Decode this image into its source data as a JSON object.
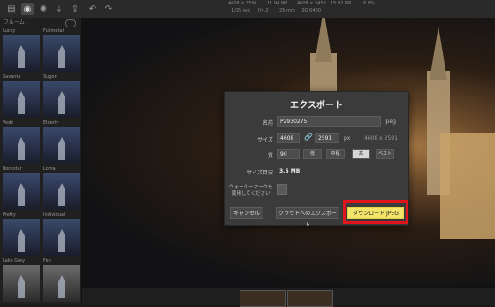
{
  "toolbar": {
    "icons": [
      "layers-icon",
      "photo-icon",
      "effects-icon",
      "download-icon",
      "share-icon",
      "undo-icon",
      "redo-icon"
    ],
    "meta_row1": [
      "4608 × 2591",
      "11.94 MP",
      "4608 × 3456",
      "15.92 MP",
      "16.9%"
    ],
    "meta_row2": [
      "1/25 sec",
      "f/4.2",
      "25 mm",
      "ISO 6400"
    ]
  },
  "sidebar": {
    "header": "フルーム",
    "filters": [
      {
        "left": "Lucky",
        "right": "Fullmetal"
      },
      {
        "left": "Savanta",
        "right": "Sugon"
      },
      {
        "left": "Vodz",
        "right": "Elderly"
      },
      {
        "left": "Rockstar",
        "right": "Loma"
      },
      {
        "left": "Pretty",
        "right": "Individual"
      },
      {
        "left": "Lake Grey",
        "right": "Fen"
      }
    ]
  },
  "dialog": {
    "title": "エクスポート",
    "name_label": "名前",
    "name_value": "P2930275",
    "ext": "jpeg",
    "size_label": "サイズ",
    "width": "4608",
    "height": "2591",
    "unit": "px",
    "orig_size": "4608 x 2591",
    "quality_label": "質",
    "quality_value": "90",
    "quality_options": [
      "低",
      "中程",
      "高",
      "ベスト"
    ],
    "selected_quality_index": 2,
    "estimate_label": "サイズ目安",
    "estimate_value": "3.5 MB",
    "watermark_label_line1": "ウォーターマークを",
    "watermark_label_line2": "使用してください",
    "cancel": "キャンセル",
    "cloud": "クラウドへのエクスポート",
    "download": "ダウンロード JPEG"
  },
  "colors": {
    "primary_button": "#f3e46a",
    "highlight": "#e0141c"
  }
}
